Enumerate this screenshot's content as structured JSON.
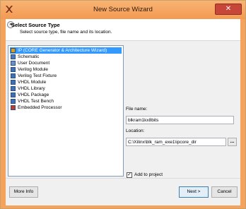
{
  "window": {
    "title": "New Source Wizard",
    "close_glyph": "✕"
  },
  "header": {
    "back_glyph": "◂",
    "title": "Select Source Type",
    "subtitle": "Select source type, file name and its location."
  },
  "source_types": [
    {
      "label": "IP (CORE Generator & Architecture Wizard)",
      "icon": "ip-core-icon",
      "color": "#d9a020",
      "selected": true
    },
    {
      "label": "Schematic",
      "icon": "schematic-icon",
      "color": "#4a79c2"
    },
    {
      "label": "User Document",
      "icon": "document-icon",
      "color": "#6b8fc9"
    },
    {
      "label": "Verilog Module",
      "icon": "verilog-module-icon",
      "color": "#3f6fb5"
    },
    {
      "label": "Verilog Test Fixture",
      "icon": "verilog-test-fixture-icon",
      "color": "#3f6fb5"
    },
    {
      "label": "VHDL Module",
      "icon": "vhdl-module-icon",
      "color": "#3f6fb5"
    },
    {
      "label": "VHDL Library",
      "icon": "vhdl-library-icon",
      "color": "#3f6fb5"
    },
    {
      "label": "VHDL Package",
      "icon": "vhdl-package-icon",
      "color": "#3f6fb5"
    },
    {
      "label": "VHDL Test Bench",
      "icon": "vhdl-test-bench-icon",
      "color": "#3f6fb5"
    },
    {
      "label": "Embedded Processor",
      "icon": "embedded-processor-icon",
      "color": "#c0392b"
    }
  ],
  "file_name": {
    "label": "File name:",
    "value": "blkram1kx8bits"
  },
  "location": {
    "label": "Location:",
    "value": "C:\\Xilinx\\blk_ram_exe1\\ipcore_dir",
    "browse_label": "..."
  },
  "add_to_project": {
    "label": "Add to project",
    "checked": true,
    "check_glyph": "✓"
  },
  "footer": {
    "more_info": "More Info",
    "next": "Next >",
    "cancel": "Cancel"
  }
}
